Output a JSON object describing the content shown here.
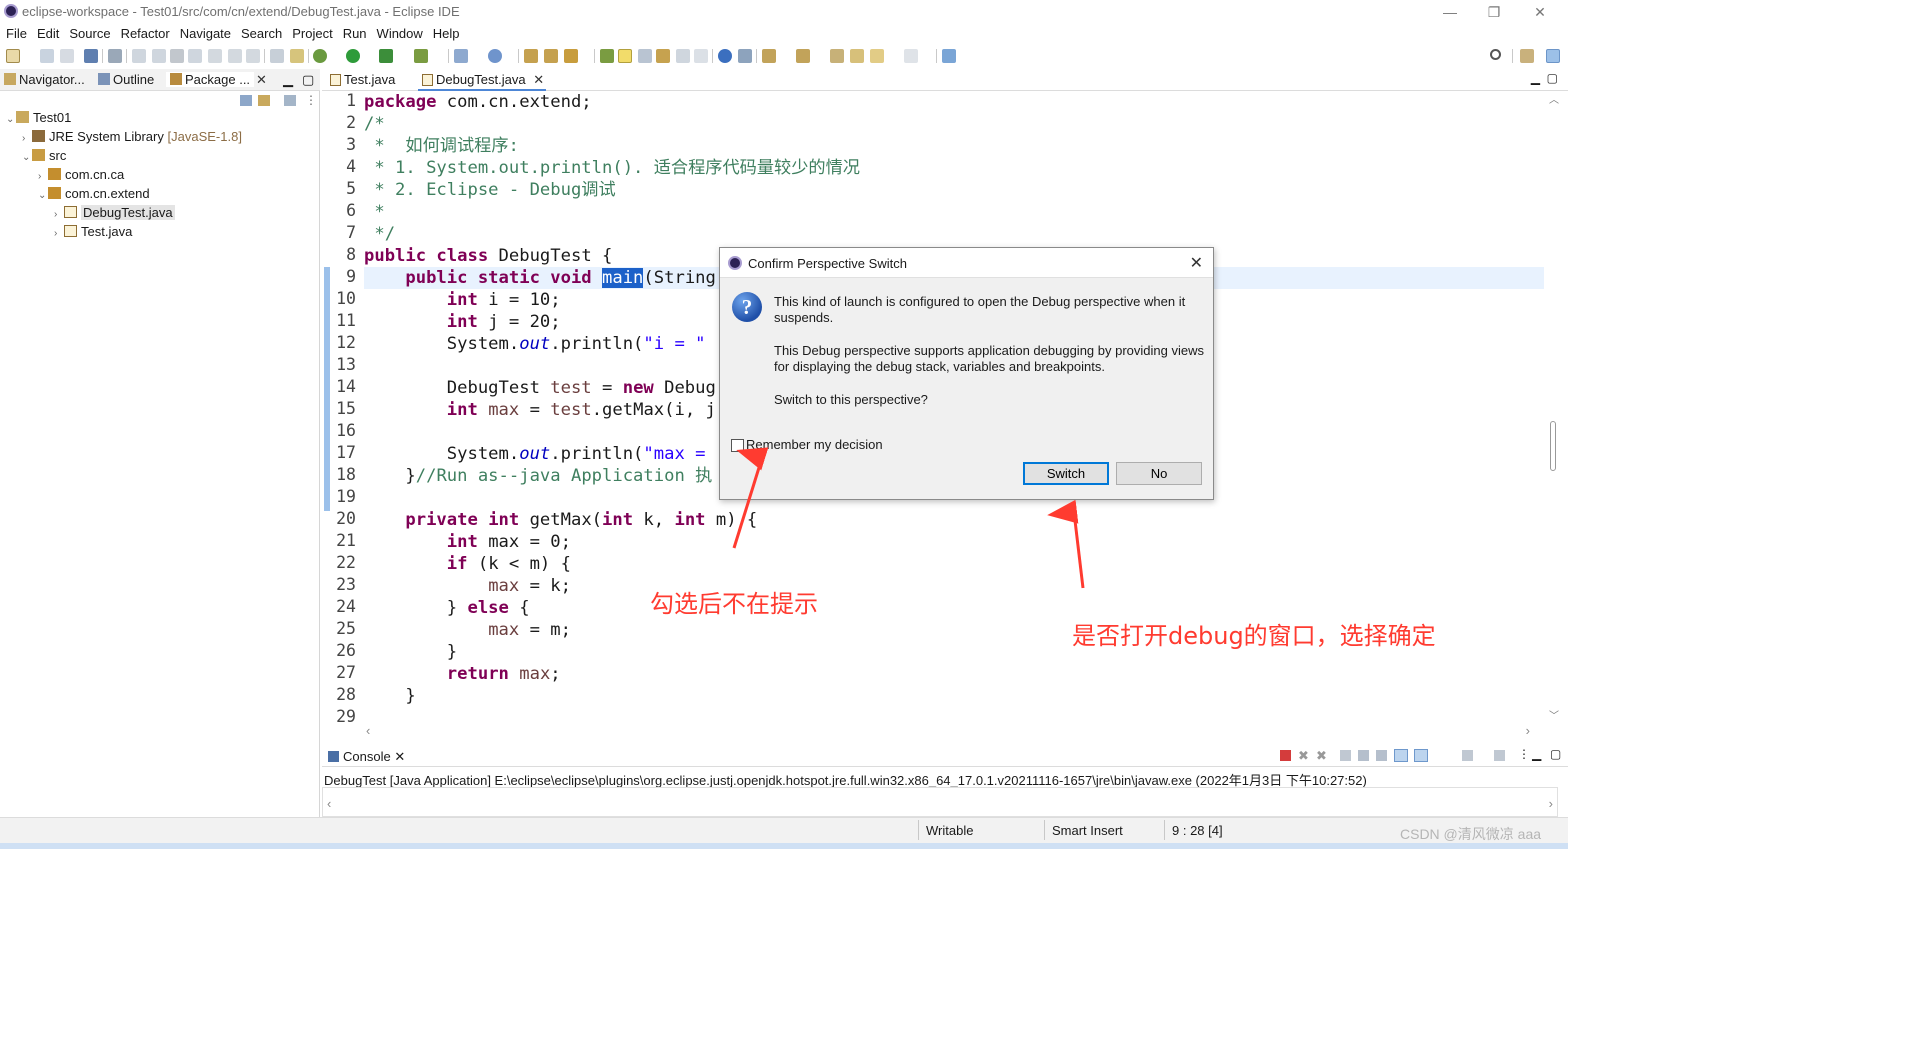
{
  "window": {
    "title": "eclipse-workspace - Test01/src/com/cn/extend/DebugTest.java - Eclipse IDE",
    "minimize_glyph": "—",
    "restore_glyph": "❐",
    "close_glyph": "✕"
  },
  "menu": [
    "File",
    "Edit",
    "Source",
    "Refactor",
    "Navigate",
    "Search",
    "Project",
    "Run",
    "Window",
    "Help"
  ],
  "left_panel": {
    "tabs": [
      "Navigator...",
      "Outline",
      "Package ..."
    ],
    "tree": [
      {
        "label": "Test01",
        "suffix": ""
      },
      {
        "label": "JRE System Library",
        "suffix": "[JavaSE-1.8]"
      },
      {
        "label": "src",
        "suffix": ""
      },
      {
        "label": "com.cn.ca",
        "suffix": ""
      },
      {
        "label": "com.cn.extend",
        "suffix": ""
      },
      {
        "label": "DebugTest.java",
        "suffix": ""
      },
      {
        "label": "Test.java",
        "suffix": ""
      }
    ]
  },
  "editor": {
    "tabs": [
      "Test.java",
      "DebugTest.java"
    ],
    "line_numbers": [
      "1",
      "2",
      "3",
      "4",
      "5",
      "6",
      "7",
      "8",
      "9",
      "10",
      "11",
      "12",
      "13",
      "14",
      "15",
      "16",
      "17",
      "18",
      "19",
      "20",
      "21",
      "22",
      "23",
      "24",
      "25",
      "26",
      "27",
      "28",
      "29"
    ],
    "code": {
      "l1_kw": "package",
      "l1_rest": " com.cn.extend;",
      "l2": "/*",
      "l3": " *  如何调试程序:",
      "l4": " * 1. System.out.println(). 适合程序代码量较少的情况",
      "l5": " * 2. Eclipse - Debug调试",
      "l6": " *",
      "l7": " */",
      "l8_kw": "public class",
      "l8_rest": " DebugTest {",
      "l9_kw": "    public static void",
      "l9_main": "main",
      "l9_rest": "(String",
      "int_kw": "int",
      "l10_rest": " i = 10;",
      "l11_rest": " j = 20;",
      "l12_a": "        System.",
      "l12_out": "out",
      "l12_b": ".println(",
      "l12_str": "\"i = \"",
      "l14_a": "        DebugTest ",
      "l14_var": "test",
      "l14_b": " = ",
      "l14_new": "new",
      "l14_c": " Debug",
      "l15_a": " ",
      "l15_var": "max",
      "l15_b": " = ",
      "l15_var2": "test",
      "l15_c": ".getMax(i, j",
      "l17_a": "        System.",
      "l17_out": "out",
      "l17_b": ".println(",
      "l17_str": "\"max =",
      "l18_a": "    }",
      "l18_cm": "//Run as--java Application 执",
      "l20_kw": "    private",
      "l20_int": "int",
      "l20_a": " getMax(",
      "l20_int2": "int",
      "l20_b": " k, ",
      "l20_int3": "int",
      "l20_c": " m) {",
      "l21_rest": " max = 0;",
      "l22_kw": "if",
      "l22_rest": " (k < m) {",
      "l23_a": "            ",
      "l23_var": "max",
      "l23_b": " = k;",
      "l24_a": "        } ",
      "l24_kw": "else",
      "l24_b": " {",
      "l25_a": "            ",
      "l25_var": "max",
      "l25_b": " = m;",
      "l26": "        }",
      "l27_kw": "return",
      "l27_a": " ",
      "l27_var": "max",
      "l27_b": ";",
      "l28": "    }"
    }
  },
  "console": {
    "tab": "Console",
    "launch": "DebugTest [Java Application] E:\\eclipse\\eclipse\\plugins\\org.eclipse.justj.openjdk.hotspot.jre.full.win32.x86_64_17.0.1.v20211116-1657\\jre\\bin\\javaw.exe  (2022年1月3日 下午10:27:52)"
  },
  "status": {
    "writable": "Writable",
    "insert_mode": "Smart Insert",
    "position": "9 : 28 [4]"
  },
  "dialog": {
    "title": "Confirm Perspective Switch",
    "icon": "question-icon",
    "message_1": "This kind of launch is configured to open the Debug perspective when it suspends.",
    "message_2": "This Debug perspective supports application debugging by providing views for displaying the debug stack, variables and breakpoints.",
    "message_3": "Switch to this perspective?",
    "remember_label": "Remember my decision",
    "remember_checked": false,
    "switch_label": "Switch",
    "no_label": "No"
  },
  "annotations": {
    "checkbox_note": "勾选后不在提示",
    "switch_note": "是否打开debug的窗口，选择确定",
    "color": "#ff3b30"
  },
  "watermark": "CSDN @清风微凉 aaa"
}
